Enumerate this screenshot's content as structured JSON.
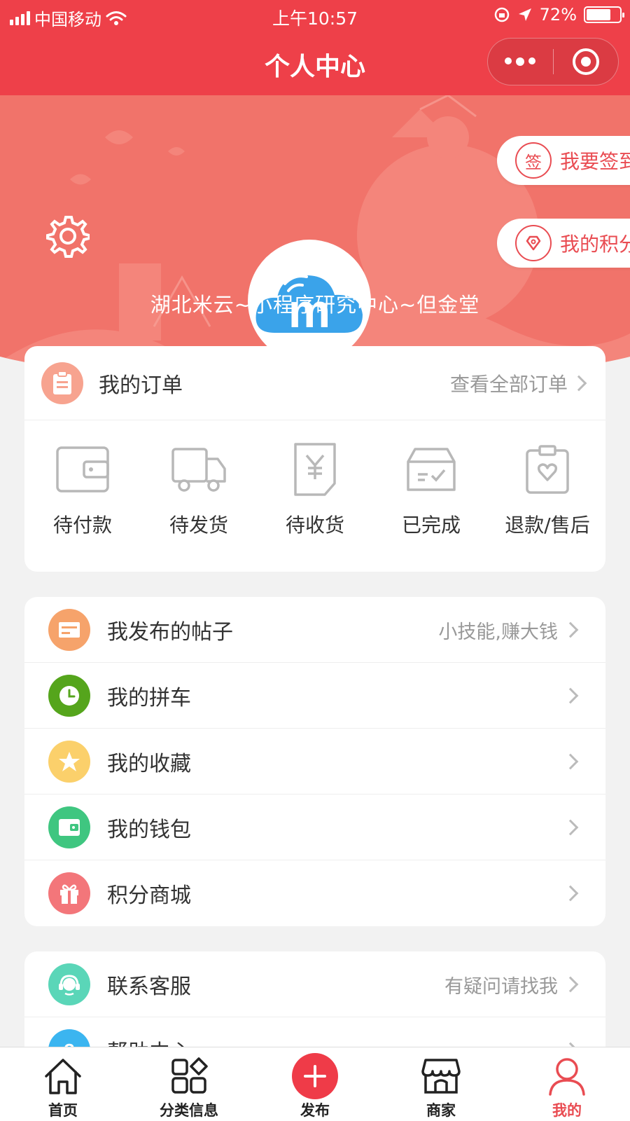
{
  "status_bar": {
    "carrier": "中国移动",
    "time": "上午10:57",
    "battery": "72%"
  },
  "nav": {
    "title": "个人中心"
  },
  "profile": {
    "username": "湖北米云~小程序研究中心~但金堂",
    "avatar_letter": "m",
    "sign_in_icon_char": "签",
    "sign_in_label": "我要签到",
    "points_label": "我的积分"
  },
  "orders": {
    "title": "我的订单",
    "view_all": "查看全部订单",
    "states": [
      {
        "label": "待付款",
        "icon": "wallet-icon"
      },
      {
        "label": "待发货",
        "icon": "truck-icon"
      },
      {
        "label": "待收货",
        "icon": "yen-receipt-icon"
      },
      {
        "label": "已完成",
        "icon": "box-check-icon"
      },
      {
        "label": "退款/售后",
        "icon": "clipboard-heart-icon"
      }
    ]
  },
  "menu1": [
    {
      "label": "我发布的帖子",
      "hint": "小技能,赚大钱",
      "icon": "post-icon",
      "color": "#f6a36b"
    },
    {
      "label": "我的拼车",
      "hint": "",
      "icon": "clock-icon",
      "color": "#55a51c"
    },
    {
      "label": "我的收藏",
      "hint": "",
      "icon": "star-icon",
      "color": "#fbd06b"
    },
    {
      "label": "我的钱包",
      "hint": "",
      "icon": "wallet-icon",
      "color": "#3fc680"
    },
    {
      "label": "积分商城",
      "hint": "",
      "icon": "gift-icon",
      "color": "#f3767a"
    }
  ],
  "menu2": [
    {
      "label": "联系客服",
      "hint": "有疑问请找我",
      "icon": "customer-service-icon",
      "color": "#5ad6b8"
    },
    {
      "label": "帮助中心",
      "hint": "",
      "icon": "help-icon",
      "color": "#3bb5f0"
    }
  ],
  "tabbar": [
    {
      "label": "首页",
      "icon": "home-icon",
      "active": false
    },
    {
      "label": "分类信息",
      "icon": "grid-icon",
      "active": false
    },
    {
      "label": "发布",
      "icon": "plus-icon",
      "active": false
    },
    {
      "label": "商家",
      "icon": "store-icon",
      "active": false
    },
    {
      "label": "我的",
      "icon": "user-icon",
      "active": true
    }
  ],
  "colors": {
    "primary": "#ee4049",
    "hero": "#f1736a"
  }
}
